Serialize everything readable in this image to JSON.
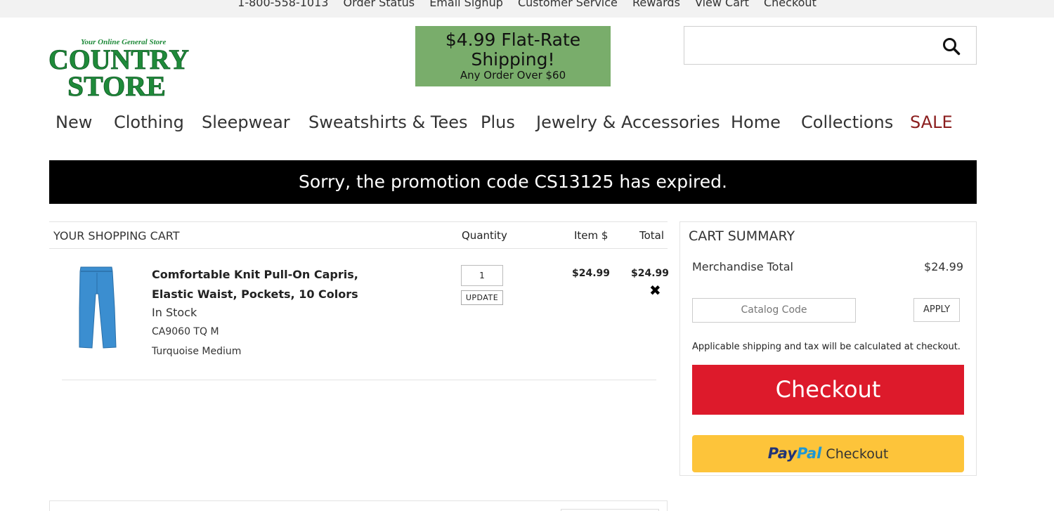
{
  "top_links": [
    "1-800-558-1013",
    "Order Status",
    "Email Signup",
    "Customer Service",
    "Rewards",
    "View Cart",
    "Checkout"
  ],
  "logo": {
    "tagline": "Your Online General Store",
    "line1": "COUNTRY",
    "line2": "STORE"
  },
  "promo": {
    "line1": "$4.99 Flat-Rate",
    "line2": "Shipping!",
    "line3": "Any Order Over $60"
  },
  "search": {
    "placeholder": ""
  },
  "nav": [
    "New",
    "Clothing",
    "Sleepwear",
    "Sweatshirts & Tees",
    "Plus",
    "Jewelry & Accessories",
    "Home",
    "Collections",
    "SALE"
  ],
  "alert": "Sorry, the promotion code CS13125 has expired.",
  "cart": {
    "title": "YOUR SHOPPING CART",
    "col_quantity": "Quantity",
    "col_item_price": "Item $",
    "col_total": "Total",
    "item": {
      "name": "Comfortable Knit Pull-On Capris, Elastic Waist, Pockets, 10 Colors",
      "stock": "In Stock",
      "sku": "CA9060 TQ M",
      "variant": "Turquoise Medium",
      "quantity": "1",
      "update_label": "UPDATE",
      "item_price": "$24.99",
      "total": "$24.99",
      "remove_glyph": "✖"
    }
  },
  "summary": {
    "title": "CART SUMMARY",
    "merch_label": "Merchandise Total",
    "merch_value": "$24.99",
    "code_placeholder": "Catalog Code",
    "apply_label": "APPLY",
    "shipping_note": "Applicable shipping and tax will be calculated at checkout.",
    "checkout_label": "Checkout",
    "paypal_pay": "Pay",
    "paypal_pal": "Pal",
    "paypal_checkout": "Checkout"
  },
  "colors": {
    "promo_green": "#79ad6b",
    "logo_green": "#1f8a3a",
    "checkout_red": "#dd1a2b",
    "paypal_yellow": "#fdc43a",
    "product_blue": "#3b8ed0",
    "sale_red": "#8b1e1e"
  }
}
